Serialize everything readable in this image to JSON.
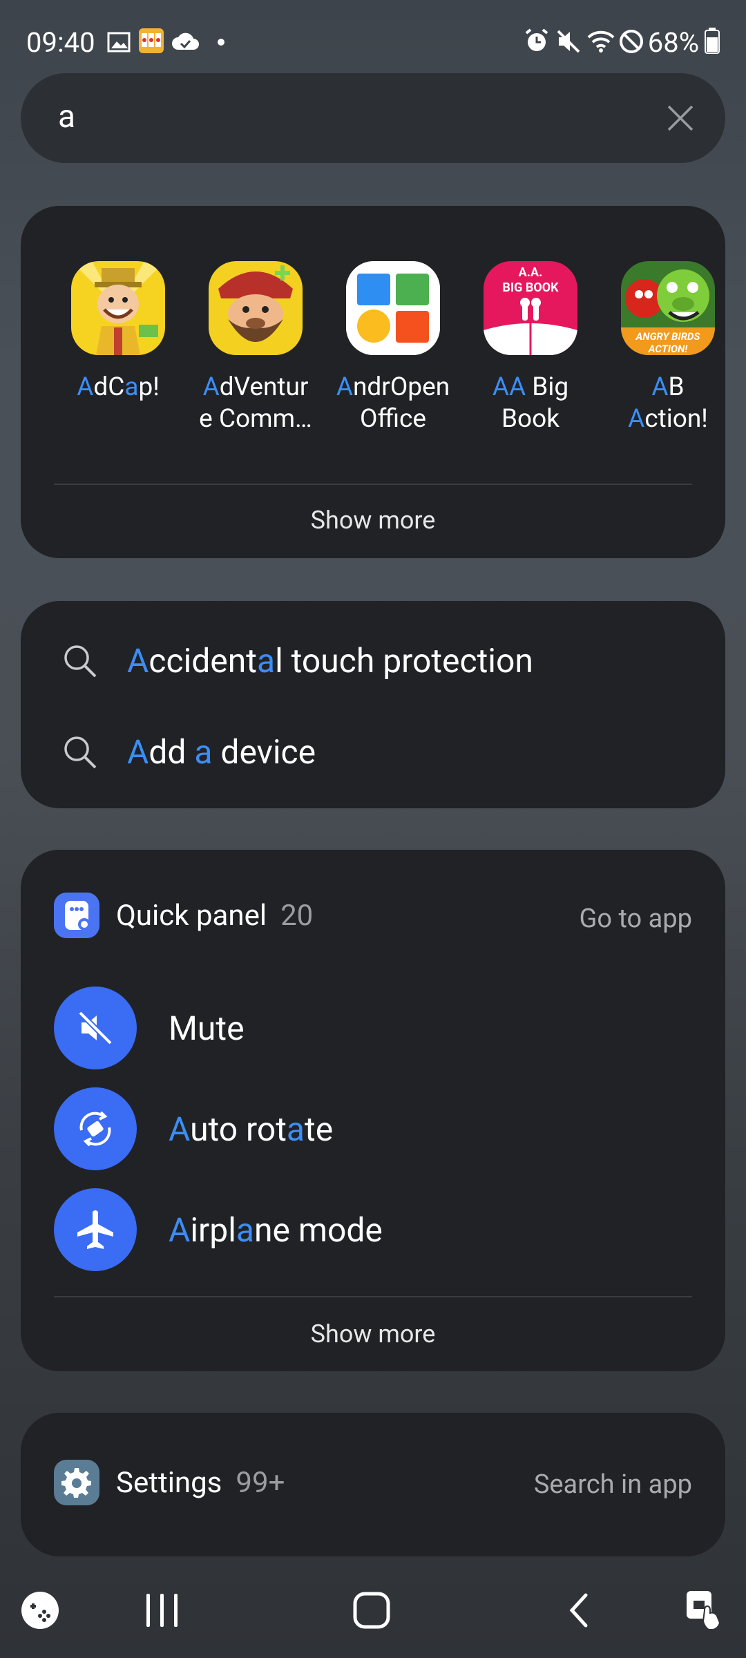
{
  "status": {
    "time": "09:40",
    "battery": "68%"
  },
  "search": {
    "query": "a"
  },
  "apps": {
    "items": [
      {
        "pre": "A",
        "mid1": "dC",
        "hl": "a",
        "post": "p!"
      },
      {
        "pre": "A",
        "mid1": "dVentur",
        "line2": "e Comm…"
      },
      {
        "pre": "A",
        "mid1": "ndrOpen",
        "line2": "Office"
      },
      {
        "pre": "AA",
        "mid1": " Big",
        "line2": "Book"
      },
      {
        "pre": "A",
        "mid1": "B",
        "line2a": "A",
        "line2b": "ction!"
      }
    ],
    "show_more": "Show more",
    "aa_icon_text1": "A.A.",
    "aa_icon_text2": "BIG BOOK",
    "ab_icon_text": "ANGRY BIRDS ACTION!"
  },
  "suggestions": [
    {
      "a": "A",
      "b": "ccident",
      "c": "a",
      "d": "l touch protection"
    },
    {
      "a": "A",
      "b": "dd ",
      "c": "a",
      "d": " device"
    }
  ],
  "quick_panel": {
    "title": "Quick panel",
    "count": "20",
    "go_to_app": "Go to app",
    "toggles": [
      {
        "plain": "Mute"
      },
      {
        "a": "A",
        "b": "uto rot",
        "c": "a",
        "d": "te"
      },
      {
        "a": "A",
        "b": "irpl",
        "c": "a",
        "d": "ne mode"
      }
    ],
    "show_more": "Show more"
  },
  "settings": {
    "title": "Settings",
    "count": "99+",
    "action": "Search in app"
  },
  "colors": {
    "accent": "#3b8ef5",
    "toggle": "#3a6cf4",
    "card": "#202226"
  }
}
